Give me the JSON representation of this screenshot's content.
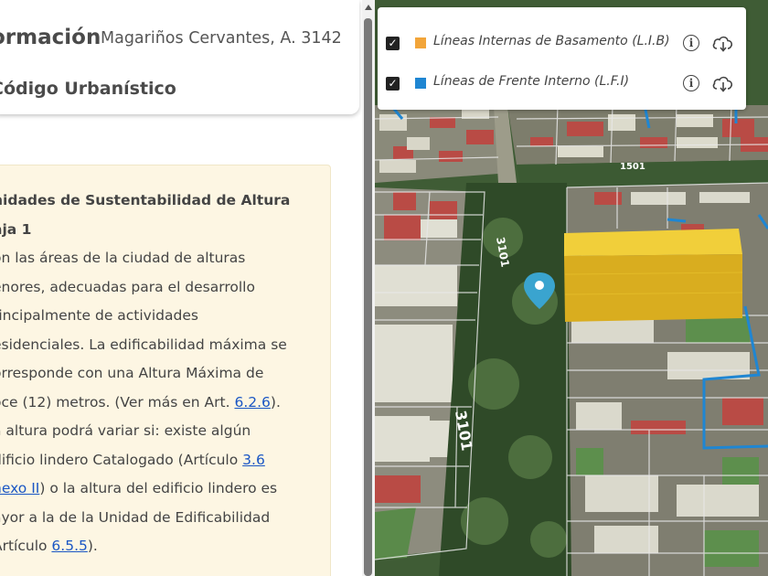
{
  "header": {
    "title": "ormación",
    "address": "Magariños Cervantes, A. 3142",
    "section": "Código Urbanístico"
  },
  "note": {
    "heading1": "nidades de Sustentabilidad de Altura",
    "heading2": "aja 1",
    "lines": [
      "on las áreas de la ciudad de alturas",
      "enores, adecuadas para el desarrollo",
      "rincipalmente de actividades",
      "esidenciales. La edificabilidad máxima se",
      "orresponde con una Altura Máxima de"
    ],
    "line6_pre": "oce (12) metros. (Ver más en Art. ",
    "line6_link": "6.2.6",
    "line6_post": ").",
    "line7": "a altura podrá variar si: existe algún",
    "line8_pre": "dificio lindero Catalogado (Artículo ",
    "line8_link": "3.6",
    "line9_link": "nexo II",
    "line9_post": ") o la altura del edificio lindero es",
    "line10": "ayor a la de la Unidad de Edificabilidad",
    "line11_pre": "Artículo ",
    "line11_link": "6.5.5",
    "line11_post": ")."
  },
  "layers": [
    {
      "label": "Líneas Internas de Basamento (L.I.B)",
      "color": "#f2a53a",
      "checked": true,
      "icons": [
        "info-icon",
        "cloud-download-icon"
      ]
    },
    {
      "label": "Líneas de Frente Interno (L.F.I)",
      "color": "#1f86d2",
      "checked": true,
      "icons": [
        "info-icon",
        "cloud-download-icon"
      ]
    }
  ],
  "map": {
    "street_labels": [
      "1501",
      "3101",
      "3101"
    ],
    "building_color": "#e5c12b",
    "lfi_line_color": "#1f86d2",
    "marker_color": "#3aa4cf",
    "icons": [
      "location-pin-icon"
    ]
  },
  "colors": {
    "link": "#1a56c4",
    "note_background": "#fdf6e3"
  }
}
